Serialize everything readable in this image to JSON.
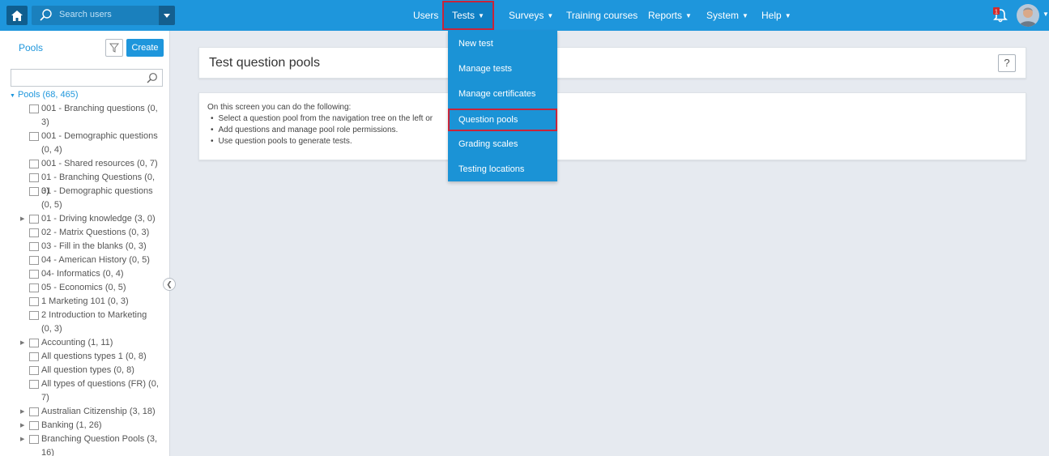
{
  "topbar": {
    "search_placeholder": "Search users",
    "nav": [
      {
        "label": "Users"
      },
      {
        "label": "Tests"
      },
      {
        "label": "Surveys"
      },
      {
        "label": "Training courses"
      },
      {
        "label": "Reports"
      },
      {
        "label": "System"
      },
      {
        "label": "Help"
      }
    ],
    "notification_count": "1"
  },
  "sidebar": {
    "title": "Pools",
    "create_label": "Create",
    "tree_root": "Pools (68, 465)",
    "nodes": [
      {
        "label": "001 - Branching questions (0, 3)"
      },
      {
        "label": "001 - Demographic questions (0, 4)"
      },
      {
        "label": "001 - Shared resources (0, 7)"
      },
      {
        "label": "01 - Branching Questions (0, 3)"
      },
      {
        "label": "01 - Demographic questions (0, 5)"
      },
      {
        "label": "01 - Driving knowledge (3, 0)"
      },
      {
        "label": "02 - Matrix Questions (0, 3)"
      },
      {
        "label": "03 - Fill in the blanks (0, 3)"
      },
      {
        "label": "04 - American History (0, 5)"
      },
      {
        "label": "04- Informatics (0, 4)"
      },
      {
        "label": "05 - Economics (0, 5)"
      },
      {
        "label": "1 Marketing 101 (0, 3)"
      },
      {
        "label": "2 Introduction to Marketing (0, 3)"
      },
      {
        "label": "Accounting (1, 11)"
      },
      {
        "label": "All questions types 1 (0, 8)"
      },
      {
        "label": "All question types (0, 8)"
      },
      {
        "label": "All types of questions (FR) (0, 7)"
      },
      {
        "label": "Australian Citizenship (3, 18)"
      },
      {
        "label": "Banking (1, 26)"
      },
      {
        "label": "Branching Question Pools (3, 16)"
      }
    ]
  },
  "main": {
    "title": "Test question pools",
    "help_label": "?",
    "intro": "On this screen you can do the following:",
    "bullets": [
      "Select a question pool from the navigation tree on the left or",
      "Add questions and manage pool role permissions.",
      "Use question pools to generate tests."
    ]
  },
  "dropdown": {
    "items": [
      {
        "label": "New test"
      },
      {
        "label": "Manage tests"
      },
      {
        "label": "Manage certificates"
      },
      {
        "label": "Question pools"
      },
      {
        "label": "Grading scales"
      },
      {
        "label": "Testing locations"
      }
    ]
  },
  "colors": {
    "topbar": "#1e96dc",
    "highlight": "#c8243a",
    "background": "#e6eaf0"
  }
}
